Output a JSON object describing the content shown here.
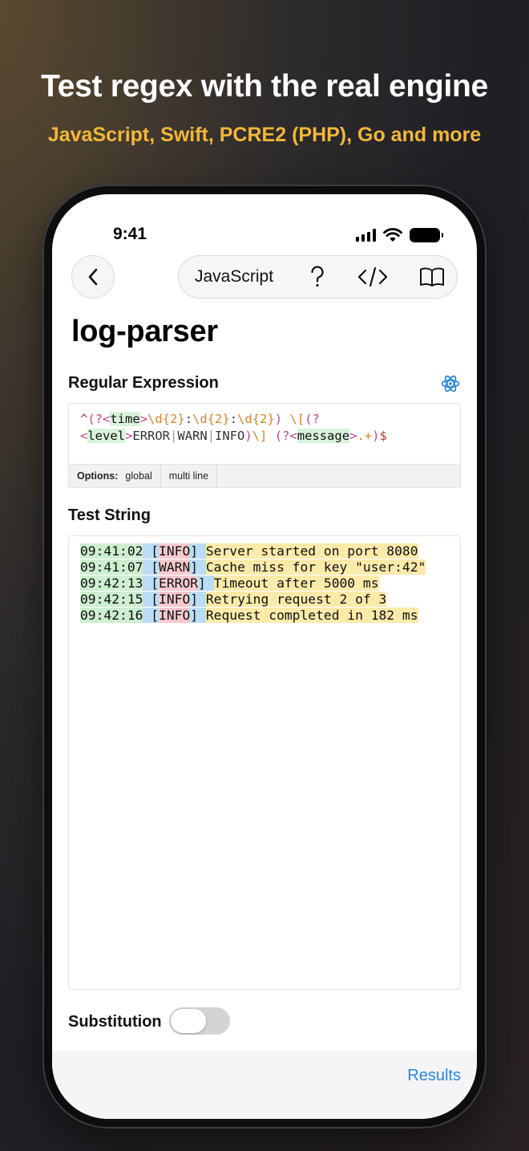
{
  "promo": {
    "title": "Test regex with the real engine",
    "subtitle": "JavaScript, Swift, PCRE2 (PHP), Go and more"
  },
  "status_bar": {
    "time": "9:41"
  },
  "toolbar": {
    "engine": "JavaScript",
    "help_icon": "question-mark-icon",
    "code_icon": "code-brackets-icon",
    "reference_icon": "open-book-icon"
  },
  "page": {
    "title": "log-parser"
  },
  "regex_section": {
    "label": "Regular Expression",
    "icon": "atom-icon",
    "tokens_line1": [
      {
        "t": "^",
        "c": "anchor"
      },
      {
        "t": "(?<",
        "c": "group"
      },
      {
        "t": "time",
        "c": "name"
      },
      {
        "t": ">",
        "c": "group"
      },
      {
        "t": "\\d{2}",
        "c": "esc"
      },
      {
        "t": ":",
        "c": "lit"
      },
      {
        "t": "\\d{2}",
        "c": "esc"
      },
      {
        "t": ":",
        "c": "lit"
      },
      {
        "t": "\\d{2}",
        "c": "esc"
      },
      {
        "t": ")",
        "c": "group"
      },
      {
        "t": " ",
        "c": "lit"
      },
      {
        "t": "\\[",
        "c": "esc"
      },
      {
        "t": "(?",
        "c": "group"
      }
    ],
    "tokens_line2": [
      {
        "t": "<",
        "c": "group"
      },
      {
        "t": "level",
        "c": "name"
      },
      {
        "t": ">",
        "c": "group"
      },
      {
        "t": "ERROR",
        "c": "lit"
      },
      {
        "t": "|",
        "c": "alt"
      },
      {
        "t": "WARN",
        "c": "lit"
      },
      {
        "t": "|",
        "c": "alt"
      },
      {
        "t": "INFO",
        "c": "lit"
      },
      {
        "t": ")",
        "c": "group"
      },
      {
        "t": "\\]",
        "c": "esc"
      },
      {
        "t": " ",
        "c": "lit"
      },
      {
        "t": "(?<",
        "c": "group"
      },
      {
        "t": "message",
        "c": "name"
      },
      {
        "t": ">",
        "c": "group"
      },
      {
        "t": ".+",
        "c": "esc"
      },
      {
        "t": ")",
        "c": "group"
      },
      {
        "t": "$",
        "c": "anchor"
      }
    ],
    "options_label": "Options:",
    "options": [
      "global",
      "multi line"
    ]
  },
  "test_section": {
    "label": "Test String",
    "lines": [
      {
        "time": "09:41:02",
        "level": "INFO",
        "message": "Server started on port 8080"
      },
      {
        "time": "09:41:07",
        "level": "WARN",
        "message": "Cache miss for key \"user:42\""
      },
      {
        "time": "09:42:13",
        "level": "ERROR",
        "message": "Timeout after 5000 ms"
      },
      {
        "time": "09:42:15",
        "level": "INFO",
        "message": "Retrying request 2 of 3"
      },
      {
        "time": "09:42:16",
        "level": "INFO",
        "message": "Request completed in 182 ms"
      }
    ]
  },
  "substitution": {
    "label": "Substitution",
    "enabled": false
  },
  "bottom": {
    "results_label": "Results"
  },
  "colors": {
    "accent": "#2a86d6",
    "promo_subtitle": "#f2b73a",
    "match_time": "#cdeecf",
    "match_level_group": "#bcdcf5",
    "match_level_value": "#f6c9cf",
    "match_message": "#fbeaaa"
  }
}
